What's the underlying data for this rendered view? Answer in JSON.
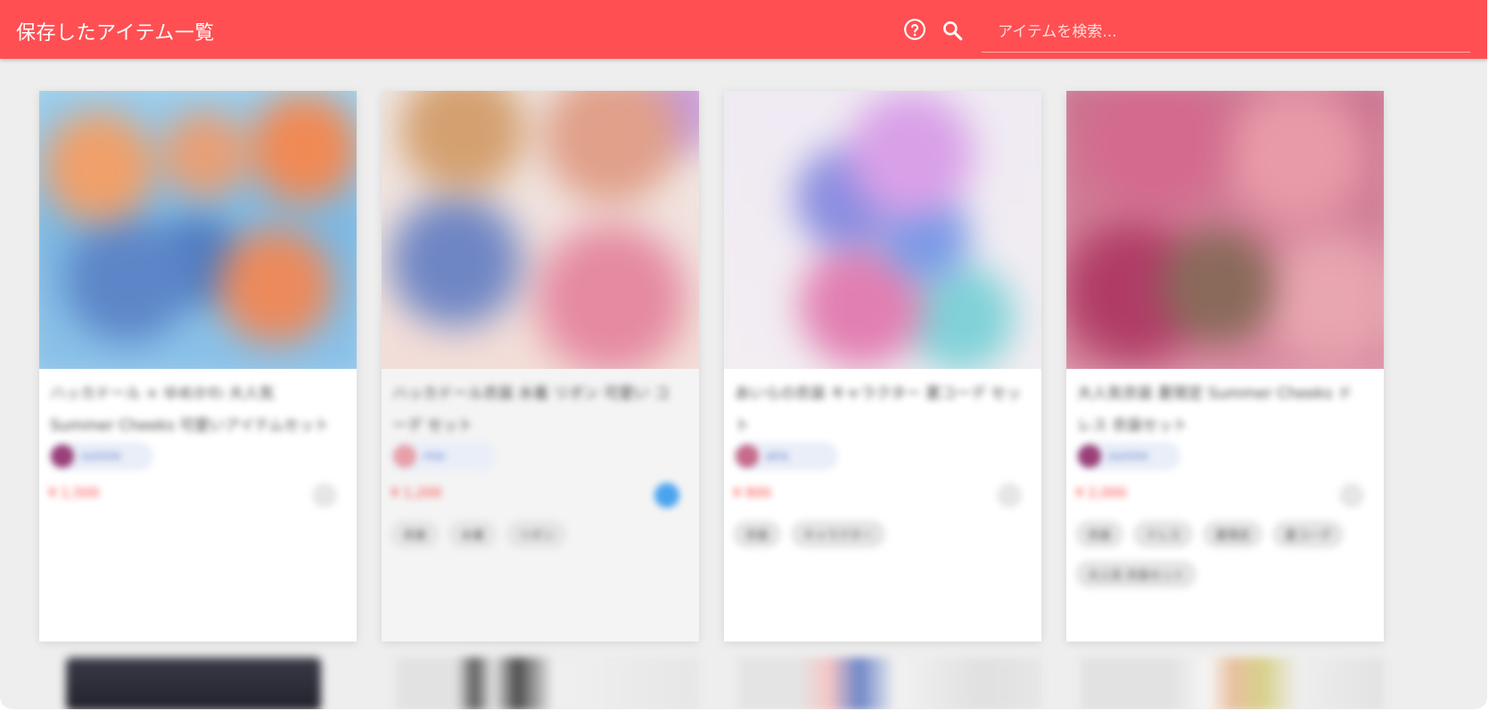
{
  "app": {
    "title": "保存したアイテム一覧",
    "search_placeholder": "アイテムを検索...",
    "help_icon": "help-circle-icon",
    "search_icon": "search-icon",
    "accent": "#ff4f52"
  },
  "items": [
    {
      "title": "ハッカドール × ゆめかわ 大人気 Summer Cheeks 可愛いアイテムセット",
      "author": "sumire",
      "price": "¥ 1,500",
      "favorited": false,
      "tags": []
    },
    {
      "title": "ハッカドール衣装 水着 リボン 可愛い コーデ セット",
      "author": "mio",
      "price": "¥ 1,200",
      "favorited": true,
      "tags": [
        "衣装",
        "水着",
        "リボン"
      ]
    },
    {
      "title": "あいらの衣装 キャラクター 夏コーデ セット",
      "author": "aira",
      "price": "¥ 800",
      "favorited": false,
      "tags": [
        "衣装",
        "キャラクター"
      ]
    },
    {
      "title": "大人気衣装 夏限定 Summer Cheeks ドレス 衣装セット",
      "author": "sumire",
      "price": "¥ 2,000",
      "favorited": false,
      "tags": [
        "衣装",
        "ドレス",
        "夏限定",
        "夏コーデ",
        "大人気 衣装セット"
      ]
    }
  ]
}
